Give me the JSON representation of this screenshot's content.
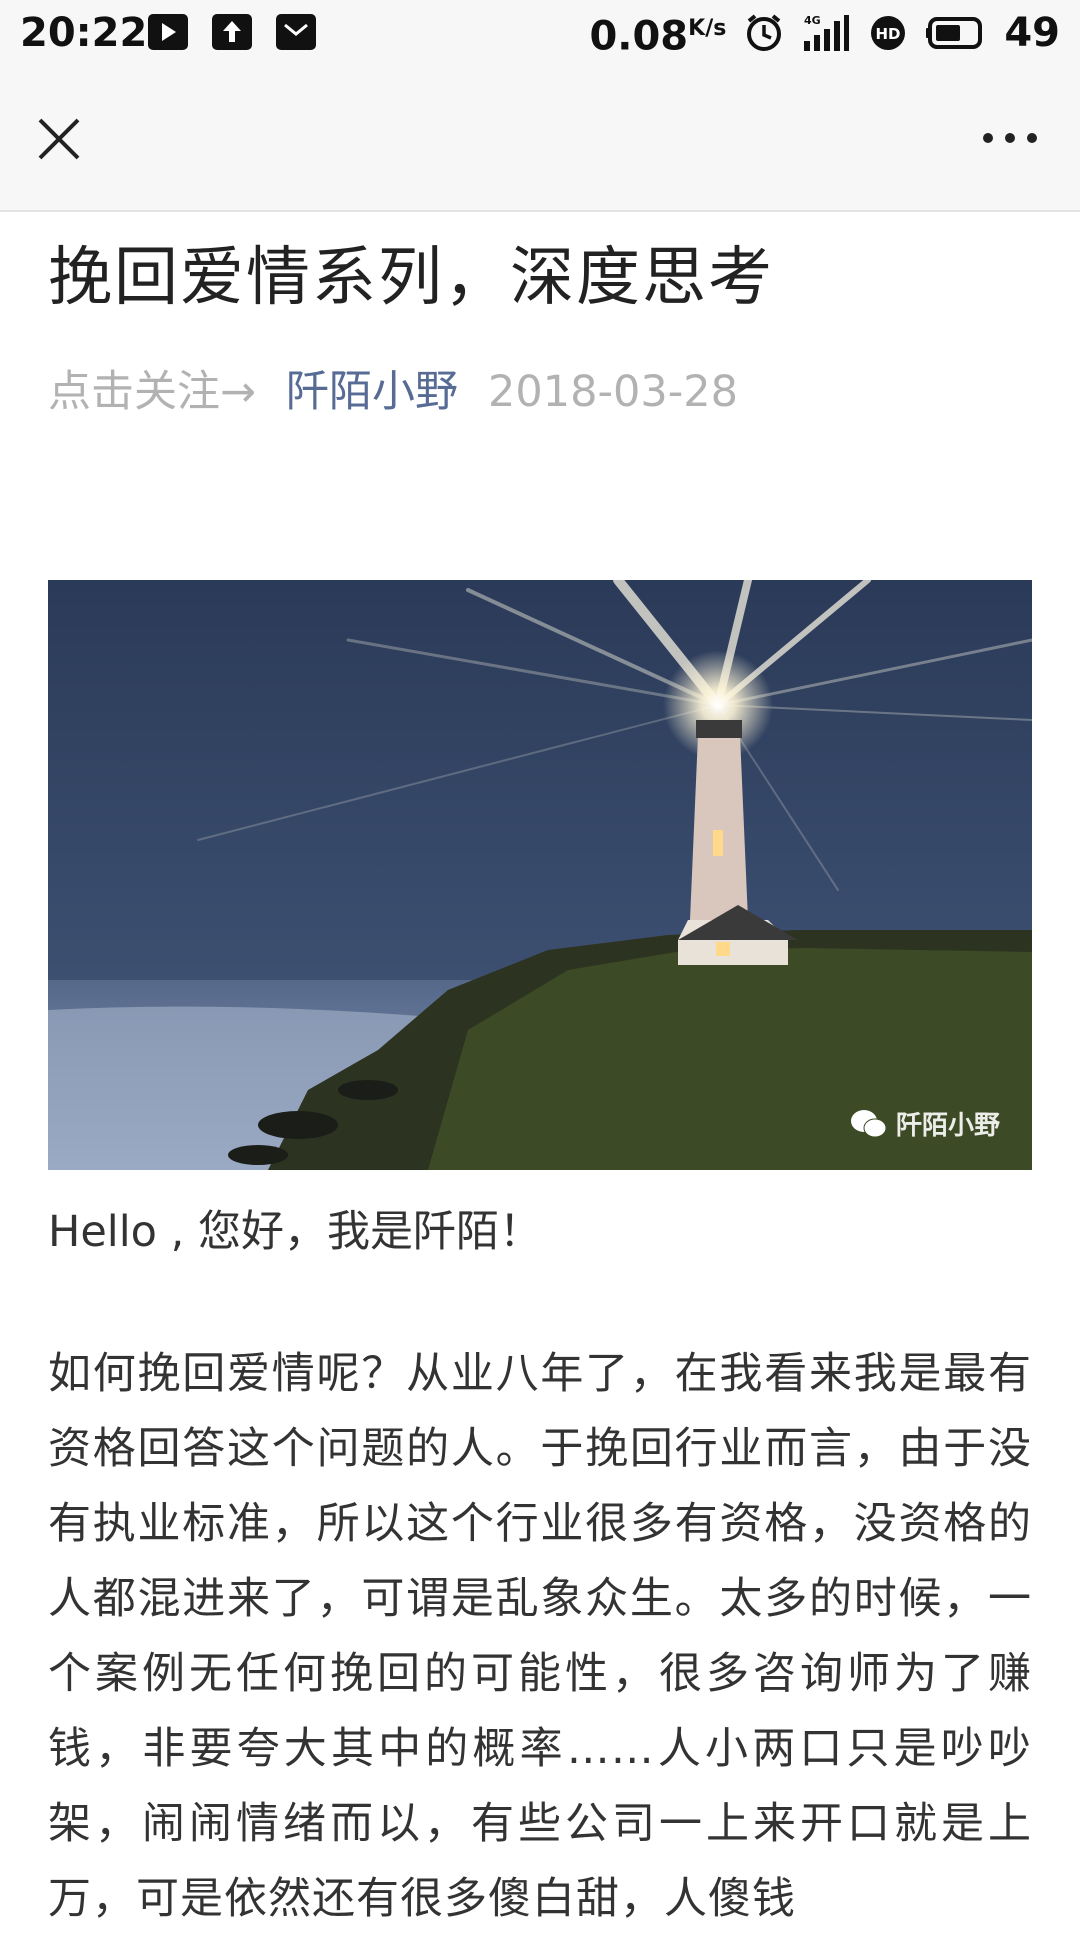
{
  "status_bar": {
    "time": "20:22",
    "speed": "0.08",
    "speed_unit": "K/s",
    "network": "4G",
    "battery": "49",
    "icons": [
      "play-icon",
      "upload-icon",
      "mail-icon",
      "alarm-icon",
      "signal-icon",
      "hd-icon",
      "battery-icon"
    ]
  },
  "nav": {
    "close_icon": "close-icon",
    "more_icon": "more-icon"
  },
  "article": {
    "title": "挽回爱情系列，深度思考",
    "follow_prompt": "点击关注→",
    "author": "阡陌小野",
    "date": "2018-03-28",
    "image_watermark": "阡陌小野",
    "greeting": "Hello , 您好，我是阡陌！",
    "body": "如何挽回爱情呢？从业八年了，在我看来我是最有资格回答这个问题的人。于挽回行业而言，由于没有执业标准，所以这个行业很多有资格，没资格的人都混进来了，可谓是乱象众生。太多的时候，一个案例无任何挽回的可能性，很多咨询师为了赚钱，非要夸大其中的概率……人小两口只是吵吵架，闹闹情绪而以，有些公司一上来开口就是上万，可是依然还有很多傻白甜，人傻钱"
  },
  "colors": {
    "link": "#576b95",
    "meta_gray": "#b2b2b2",
    "nav_bg": "#f7f7f7"
  }
}
